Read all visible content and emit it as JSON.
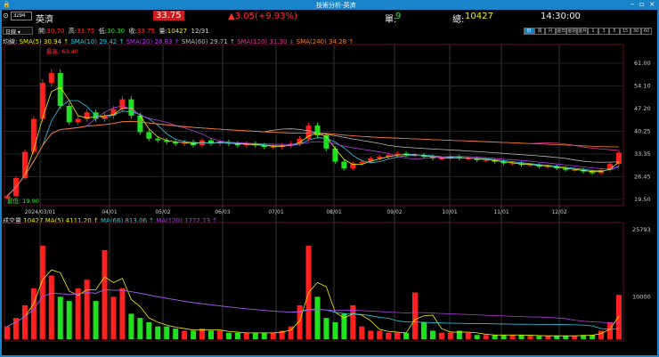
{
  "window": {
    "title": "技術分析-英濟",
    "controls": [
      "–",
      "▫",
      "×"
    ]
  },
  "quote": {
    "code": "3294",
    "name": "英濟",
    "price": "33.75",
    "change": "▲3.05(+9.93%)",
    "single_label": "單:",
    "single": "9",
    "total_label": "總:",
    "total": "10427",
    "time": "14:30:00"
  },
  "ohlc": {
    "period": "日線",
    "open_label": "開:",
    "open": "30.70",
    "high_label": "高:",
    "high": "33.75",
    "low_label": "低:",
    "low": "30.30",
    "close_label": "收:",
    "close": "33.75",
    "vol_label": "量:",
    "vol": "10427",
    "date": "12/31"
  },
  "periods": [
    "日",
    "週",
    "月",
    "還日",
    "還週",
    "還月",
    "1",
    "3",
    "5",
    "15",
    "30",
    "60"
  ],
  "ma_legend": {
    "label": "均線:",
    "items": [
      {
        "t": "SMA(5) 30.94 ↑",
        "c": "#f0f000"
      },
      {
        "t": "SMA(10) 29.42 ↑",
        "c": "#30c8e0"
      },
      {
        "t": "SMA(20) 28.83 ↑",
        "c": "#b040e0"
      },
      {
        "t": "SMA(60) 29.71 ↑",
        "c": "#bbbbbb"
      },
      {
        "t": "SMA(120) 31.30 ↓",
        "c": "#e03090"
      },
      {
        "t": "SMA(240) 34.28 ↑",
        "c": "#f08020"
      }
    ]
  },
  "vol_legend": {
    "label": "成交量",
    "value": "10427",
    "items": [
      {
        "t": "MA(5) 4111.20 ↑",
        "c": "#f0f000"
      },
      {
        "t": "MA(66) 813.06 ↑",
        "c": "#30c8e0"
      },
      {
        "t": "MA(120) 1772.73 ↑",
        "c": "#b040e0"
      }
    ]
  },
  "chart_data": {
    "type": "candlestick",
    "high_label": "最高: 63.40",
    "low_label": "最低: 19.90",
    "y_ticks": [
      "61.00",
      "54.10",
      "47.20",
      "40.25",
      "33.35",
      "26.45",
      "19.50"
    ],
    "ylim": [
      19.5,
      61
    ],
    "x_ticks": [
      "2024/03/01",
      "04/01",
      "05/02",
      "06/03",
      "07/01",
      "08/01",
      "09/02",
      "10/01",
      "11/01",
      "12/02"
    ],
    "vol_ticks": [
      "25793",
      "10000"
    ],
    "vol_lim": [
      0,
      25793
    ],
    "closes": [
      20.5,
      26,
      34,
      44,
      55,
      58,
      48,
      43,
      44,
      46,
      44,
      45,
      47,
      50,
      45,
      40,
      38,
      37.5,
      37,
      36.5,
      37,
      36,
      37.5,
      36.5,
      37,
      36.5,
      36,
      36.5,
      36,
      35.5,
      35.5,
      36,
      36.5,
      38,
      42,
      39,
      35,
      31,
      29,
      30.5,
      31,
      32,
      32.5,
      33,
      33.5,
      33,
      33,
      32.5,
      32,
      32,
      32.5,
      32,
      32,
      31.5,
      31.5,
      31,
      30.5,
      30.5,
      30,
      30,
      29.5,
      29.5,
      29,
      28.5,
      28.5,
      28,
      27.5,
      28.5,
      30.3,
      33.75
    ],
    "volumes": [
      3000,
      5000,
      8000,
      12000,
      22000,
      15000,
      10000,
      9000,
      12000,
      14000,
      9000,
      21000,
      10000,
      12000,
      6000,
      5000,
      4000,
      3000,
      3000,
      2500,
      2000,
      2000,
      2500,
      2000,
      2000,
      1500,
      1500,
      1500,
      1500,
      1500,
      1500,
      2000,
      3000,
      8000,
      22000,
      10000,
      5000,
      4000,
      6000,
      8000,
      3000,
      2000,
      2000,
      1500,
      1500,
      1500,
      11000,
      4000,
      2000,
      1500,
      1500,
      2000,
      1500,
      1000,
      1000,
      1000,
      1000,
      1000,
      1000,
      800,
      800,
      800,
      800,
      800,
      800,
      1000,
      1000,
      2000,
      4000,
      10427
    ],
    "up_color": "#ff2020",
    "down_color": "#20e020"
  }
}
